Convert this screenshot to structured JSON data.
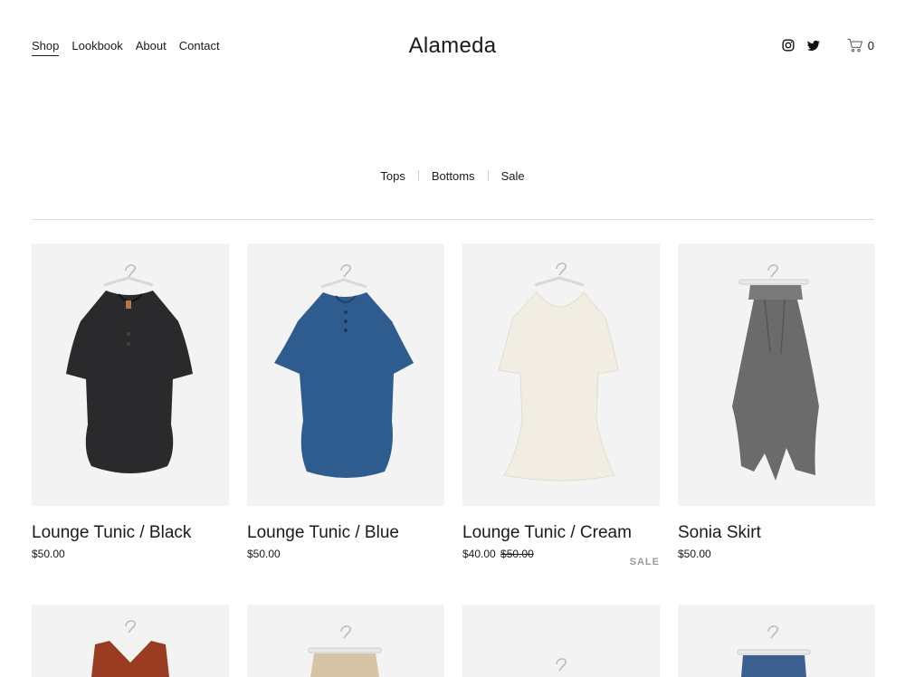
{
  "nav": {
    "items": [
      {
        "label": "Shop"
      },
      {
        "label": "Lookbook"
      },
      {
        "label": "About"
      },
      {
        "label": "Contact"
      }
    ]
  },
  "brand": {
    "name": "Alameda"
  },
  "header_icons": {
    "instagram": "instagram-icon",
    "twitter": "twitter-icon",
    "cart": "cart-icon",
    "cart_count": "0"
  },
  "categories": [
    {
      "label": "Tops"
    },
    {
      "label": "Bottoms"
    },
    {
      "label": "Sale"
    }
  ],
  "products": [
    {
      "title": "Lounge Tunic / Black",
      "price": "$50.00",
      "garment_color": "#2a2a2c"
    },
    {
      "title": "Lounge Tunic / Blue",
      "price": "$50.00",
      "garment_color": "#2f5c8f"
    },
    {
      "title": "Lounge Tunic / Cream",
      "price": "$40.00",
      "original_price": "$50.00",
      "badge": "SALE",
      "garment_color": "#f1ede2"
    },
    {
      "title": "Sonia Skirt",
      "price": "$50.00",
      "garment_color": "#6b6b6b"
    }
  ],
  "colors": {
    "image_bg": "#f3f3f3",
    "text": "#1a1a1a",
    "badge": "#9a9a9a"
  }
}
